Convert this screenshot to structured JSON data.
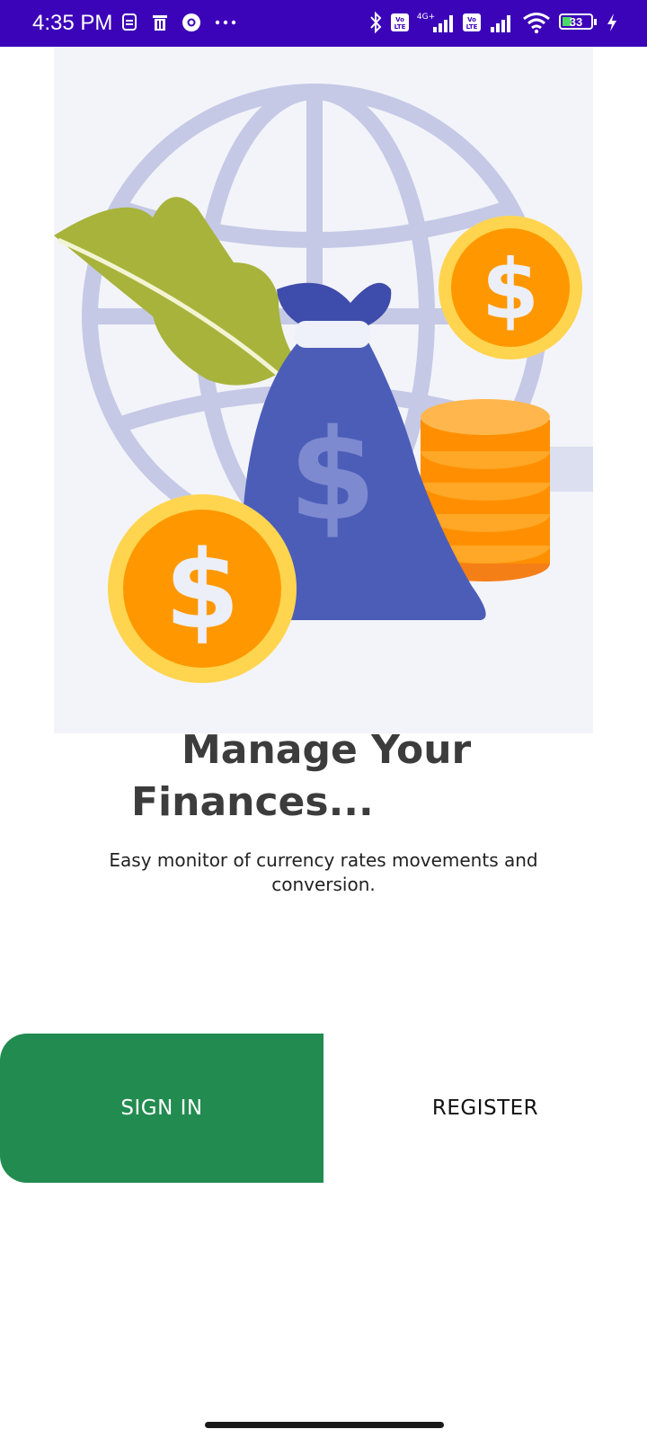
{
  "status_bar": {
    "time": "4:35 PM",
    "battery": "33",
    "network": "4G+",
    "volte_label": "Vo LTE",
    "icons": [
      "notification-icon",
      "trash-icon",
      "chrome-icon",
      "more-dots-icon",
      "bluetooth-icon",
      "volte-icon",
      "signal-icon",
      "wifi-icon",
      "battery-icon",
      "charging-icon"
    ],
    "bar_color": "#3c04b8"
  },
  "hero": {
    "illustration": "finance-illustration",
    "elements": [
      "globe",
      "leaf",
      "money-bag",
      "dollar-coin",
      "coin-stack"
    ],
    "symbol": "$"
  },
  "content": {
    "title_line1": "Manage Your",
    "title_line2": "Finances...",
    "subtitle": "Easy monitor of currency rates movements and conversion."
  },
  "actions": {
    "sign_in_label": "SIGN IN",
    "register_label": "REGISTER",
    "accent_color": "#228b50"
  }
}
